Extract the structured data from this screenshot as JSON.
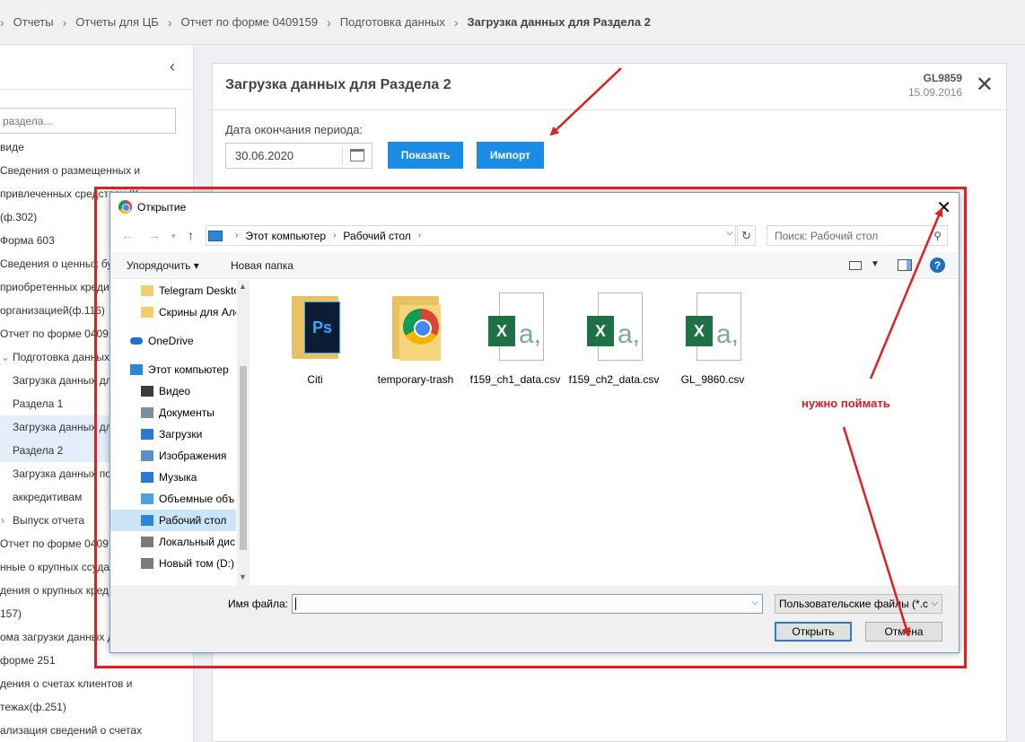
{
  "breadcrumb": [
    "Отчеты",
    "Отчеты для ЦБ",
    "Отчет по форме 0409159",
    "Подготовка данных",
    "Загрузка данных для Раздела 2"
  ],
  "sidebar": {
    "search_placeholder": "раздела...",
    "tree": [
      "виде",
      "Сведения о размещенных и",
      "привлеченных средствах (К",
      "(ф.302)",
      "Форма 603",
      "Сведения о ценных бу",
      "приобретенных кредит",
      "организацией(ф.116)",
      "Отчет по форме 04091",
      "Подготовка данных",
      "Загрузка данных дл",
      "Раздела 1",
      "Загрузка данных дл",
      "Раздела 2",
      "Загрузка данных по",
      "аккредитивам",
      "Выпуск отчета",
      "Отчет по форме 04091",
      "нные о крупных ссудах",
      "дения о крупных кред",
      "157)",
      "ома загрузки данных д",
      "форме 251",
      "дения о счетах клиентов и",
      "тежах(ф.251)",
      "ализация сведений о счетах"
    ]
  },
  "panel": {
    "title": "Загрузка данных для Раздела 2",
    "code": "GL9859",
    "date": "15.09.2016",
    "close_glyph": "✕",
    "period_label": "Дата окончания периода:",
    "period_value": "30.06.2020",
    "show_button": "Показать",
    "import_button": "Импорт"
  },
  "dialog": {
    "title": "Открытие",
    "close_glyph": "✕",
    "address": [
      "Этот компьютер",
      "Рабочий стол"
    ],
    "search_placeholder": "Поиск: Рабочий стол",
    "organize": "Упорядочить ▾",
    "new_folder": "Новая папка",
    "help": "?",
    "nav_items": [
      {
        "label": "Telegram Desktop",
        "icon": "folder-icon"
      },
      {
        "label": "Скрины для Але",
        "icon": "folder-icon"
      },
      {
        "label": "OneDrive",
        "icon": "cloud-icon"
      },
      {
        "label": "Этот компьютер",
        "icon": "computer-icon"
      },
      {
        "label": "Видео",
        "icon": "video-icon"
      },
      {
        "label": "Документы",
        "icon": "documents-icon"
      },
      {
        "label": "Загрузки",
        "icon": "download-icon"
      },
      {
        "label": "Изображения",
        "icon": "images-icon"
      },
      {
        "label": "Музыка",
        "icon": "music-icon"
      },
      {
        "label": "Объемные объ",
        "icon": "3d-objects-icon"
      },
      {
        "label": "Рабочий стол",
        "icon": "desktop-icon"
      },
      {
        "label": "Локальный дис",
        "icon": "drive-icon"
      },
      {
        "label": "Новый том (D:)",
        "icon": "drive-icon"
      }
    ],
    "files": [
      {
        "name": "Citi",
        "kind": "folder-photoshop"
      },
      {
        "name": "temporary-trash",
        "kind": "folder-chrome"
      },
      {
        "name": "f159_ch1_data.csv",
        "kind": "csv"
      },
      {
        "name": "f159_ch2_data.csv",
        "kind": "csv"
      },
      {
        "name": "GL_9860.csv",
        "kind": "csv"
      }
    ],
    "filename_label": "Имя файла:",
    "filename_value": "",
    "filetype": "Пользовательские файлы (*.c",
    "open_button": "Открыть",
    "cancel_button": "Отмена"
  },
  "annotation": {
    "note": "нужно поймать",
    "color": "#e11f1f"
  }
}
